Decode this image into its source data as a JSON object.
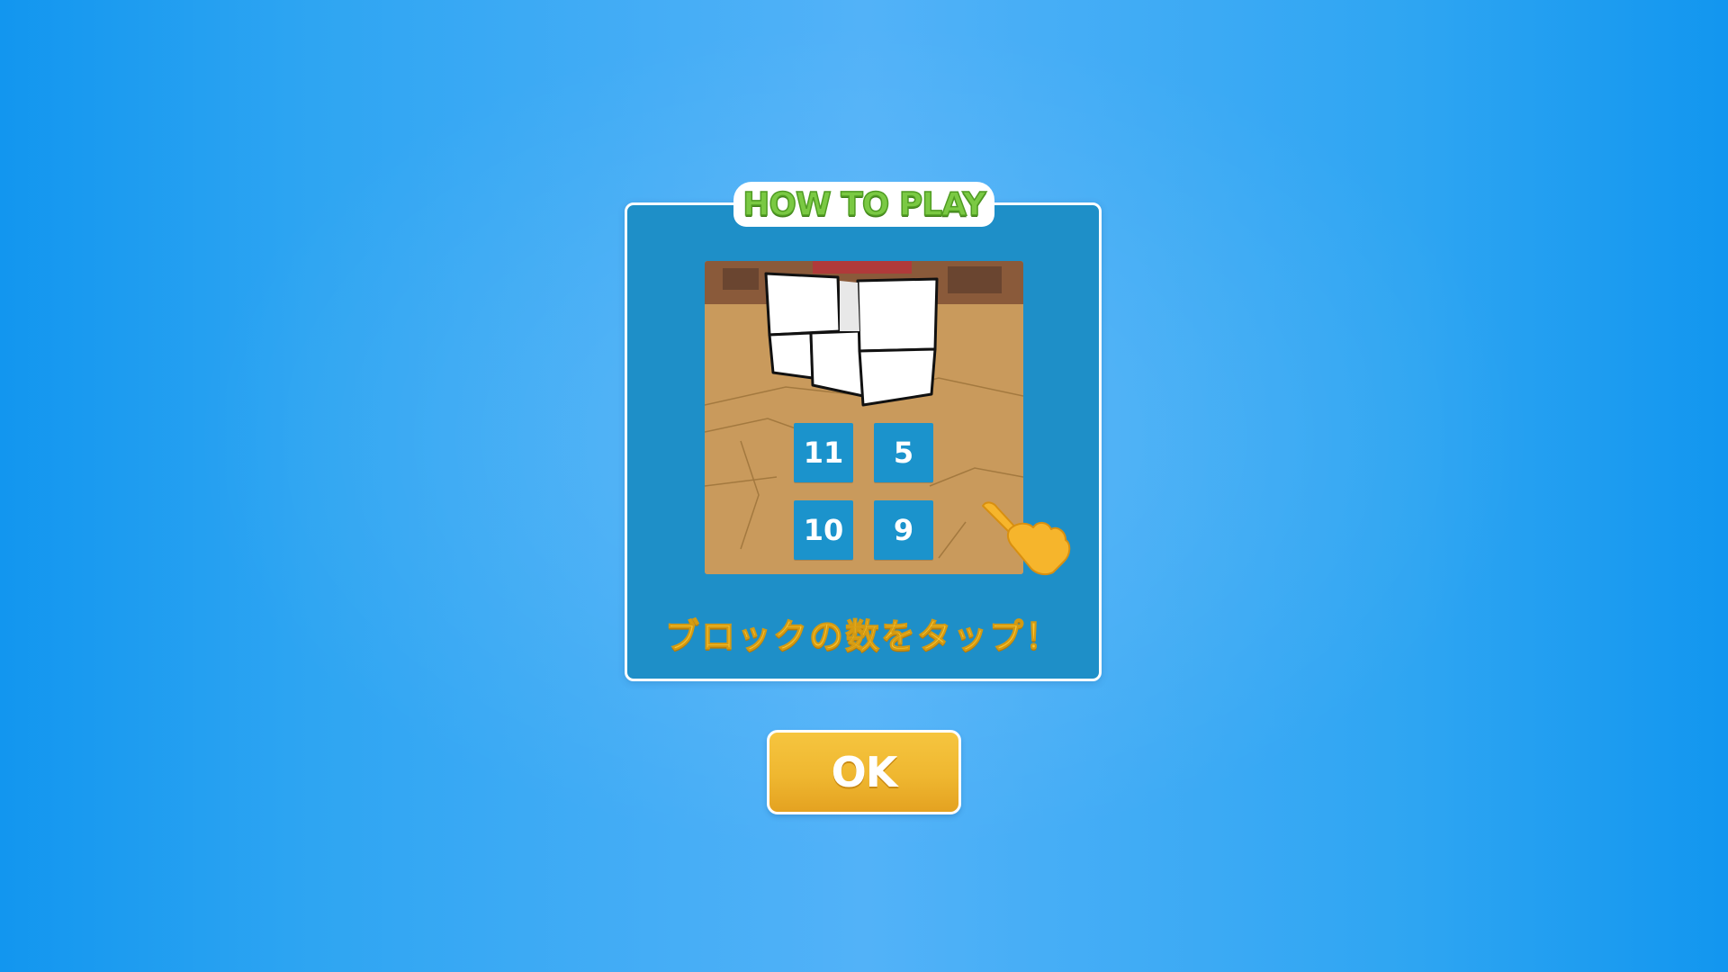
{
  "dialog": {
    "title": "HOW TO PLAY",
    "instruction": "ブロックの数をタップ！",
    "answer_options": [
      "11",
      "5",
      "10",
      "9"
    ]
  },
  "ok_button": {
    "label": "OK"
  },
  "icons": {
    "hand": "tap-hand-icon"
  },
  "colors": {
    "background": "#2ea5f2",
    "panel": "#1e8fc8",
    "title_green": "#7ac943",
    "instruction_yellow": "#f9c733",
    "ok_button": "#efb730",
    "answer_button": "#1b93cc"
  }
}
